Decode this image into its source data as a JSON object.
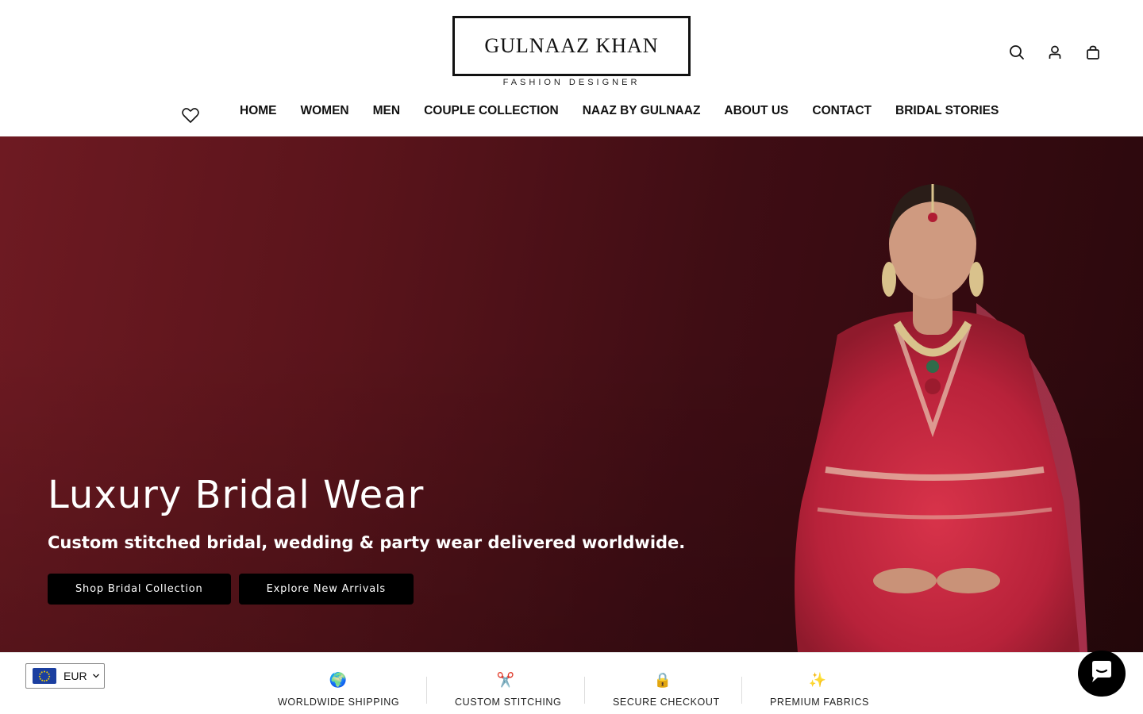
{
  "brand": {
    "name": "GULNAAZ KHAN",
    "tagline": "FASHION DESIGNER"
  },
  "header_icons": [
    "search-icon",
    "account-icon",
    "cart-icon"
  ],
  "nav": {
    "items": [
      {
        "label": "HOME"
      },
      {
        "label": "WOMEN"
      },
      {
        "label": "MEN"
      },
      {
        "label": "COUPLE COLLECTION"
      },
      {
        "label": "NAAZ BY GULNAAZ"
      },
      {
        "label": "ABOUT US"
      },
      {
        "label": "CONTACT"
      },
      {
        "label": "BRIDAL STORIES"
      }
    ]
  },
  "hero": {
    "title": "Luxury Bridal Wear",
    "subtitle": "Custom stitched bridal, wedding & party wear delivered worldwide.",
    "buttons": [
      {
        "label": "Shop Bridal Collection"
      },
      {
        "label": "Explore New Arrivals"
      }
    ],
    "background_color": "#5a141b"
  },
  "features": [
    {
      "icon": "🌍",
      "label": "WORLDWIDE SHIPPING"
    },
    {
      "icon": "✂️",
      "label": "CUSTOM STITCHING"
    },
    {
      "icon": "🔒",
      "label": "SECURE CHECKOUT"
    },
    {
      "icon": "✨",
      "label": "PREMIUM FABRICS"
    }
  ],
  "currency": {
    "code": "EUR"
  }
}
